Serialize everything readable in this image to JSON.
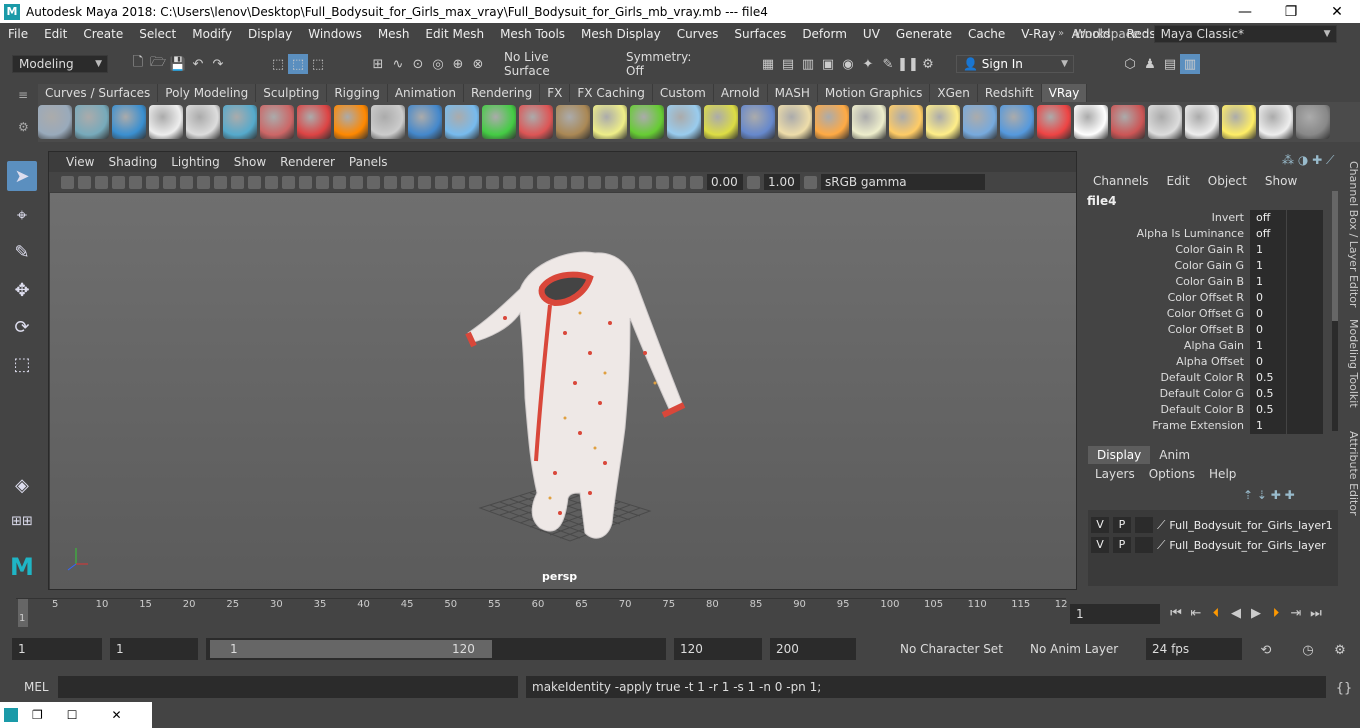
{
  "window": {
    "title": "Autodesk Maya 2018: C:\\Users\\lenov\\Desktop\\Full_Bodysuit_for_Girls_max_vray\\Full_Bodysuit_for_Girls_mb_vray.mb   ---   file4",
    "minimize": "—",
    "maximize": "❐",
    "close": "✕"
  },
  "menubar": {
    "items": [
      "File",
      "Edit",
      "Create",
      "Select",
      "Modify",
      "Display",
      "Windows",
      "Mesh",
      "Edit Mesh",
      "Mesh Tools",
      "Mesh Display",
      "Curves",
      "Surfaces",
      "Deform",
      "UV",
      "Generate",
      "Cache",
      "V-Ray",
      "Arnold",
      "Redshift"
    ],
    "workspace_label": "Workspace :",
    "workspace_value": "Maya Classic*"
  },
  "statusline": {
    "mode": "Modeling",
    "live_surface": "No Live Surface",
    "symmetry": "Symmetry: Off",
    "sign_in": "Sign In"
  },
  "shelf": {
    "tabs": [
      "Curves / Surfaces",
      "Poly Modeling",
      "Sculpting",
      "Rigging",
      "Animation",
      "Rendering",
      "FX",
      "FX Caching",
      "Custom",
      "Arnold",
      "MASH",
      "Motion Graphics",
      "XGen",
      "Redshift",
      "VRay"
    ],
    "active_tab": "VRay"
  },
  "viewport": {
    "menu": [
      "View",
      "Shading",
      "Lighting",
      "Show",
      "Renderer",
      "Panels"
    ],
    "exposure": "0.00",
    "gamma": "1.00",
    "color_space": "sRGB gamma",
    "camera": "persp"
  },
  "channelbox": {
    "menu": [
      "Channels",
      "Edit",
      "Object",
      "Show"
    ],
    "node": "file4",
    "attributes": [
      {
        "name": "Invert",
        "value": "off"
      },
      {
        "name": "Alpha Is Luminance",
        "value": "off"
      },
      {
        "name": "Color Gain R",
        "value": "1"
      },
      {
        "name": "Color Gain G",
        "value": "1"
      },
      {
        "name": "Color Gain B",
        "value": "1"
      },
      {
        "name": "Color Offset R",
        "value": "0"
      },
      {
        "name": "Color Offset G",
        "value": "0"
      },
      {
        "name": "Color Offset B",
        "value": "0"
      },
      {
        "name": "Alpha Gain",
        "value": "1"
      },
      {
        "name": "Alpha Offset",
        "value": "0"
      },
      {
        "name": "Default Color R",
        "value": "0.5"
      },
      {
        "name": "Default Color G",
        "value": "0.5"
      },
      {
        "name": "Default Color B",
        "value": "0.5"
      },
      {
        "name": "Frame Extension",
        "value": "1"
      }
    ]
  },
  "sidetabs": [
    "Channel Box / Layer Editor",
    "Modeling Toolkit",
    "Attribute Editor"
  ],
  "layers": {
    "tabs": [
      "Display",
      "Anim"
    ],
    "menu": [
      "Layers",
      "Options",
      "Help"
    ],
    "rows": [
      {
        "v": "V",
        "p": "P",
        "name": "Full_Bodysuit_for_Girls_layer1"
      },
      {
        "v": "V",
        "p": "P",
        "name": "Full_Bodysuit_for_Girls_layer"
      }
    ]
  },
  "timeline": {
    "ticks": [
      "1",
      "5",
      "10",
      "15",
      "20",
      "25",
      "30",
      "35",
      "40",
      "45",
      "50",
      "55",
      "60",
      "65",
      "70",
      "75",
      "80",
      "85",
      "90",
      "95",
      "100",
      "105",
      "110",
      "115",
      "12"
    ],
    "current_frame": "1"
  },
  "range": {
    "start": "1",
    "playback_start": "1",
    "slider_start": "1",
    "slider_end": "120",
    "playback_end": "120",
    "end": "200",
    "character_set": "No Character Set",
    "anim_layer": "No Anim Layer",
    "fps": "24 fps"
  },
  "cmdline": {
    "lang": "MEL",
    "result": "makeIdentity -apply true -t 1 -r 1 -s 1 -n 0 -pn 1;"
  },
  "colors": {
    "accent": "#5b8fbf",
    "suit_trim": "#d9473a"
  }
}
